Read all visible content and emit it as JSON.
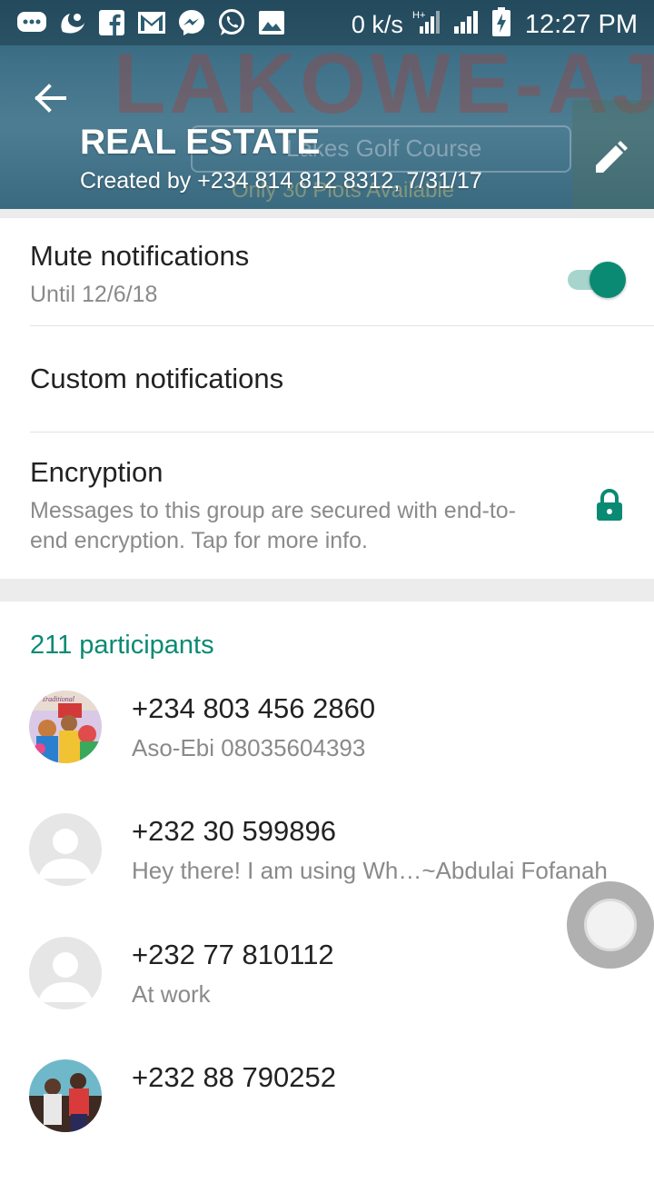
{
  "status_bar": {
    "net_speed": "0 k/s",
    "time": "12:27 PM",
    "left_icons": [
      "chat-bubble-icon",
      "uc-browser-icon",
      "facebook-icon",
      "gmail-icon",
      "messenger-icon",
      "whatsapp-icon",
      "gallery-icon"
    ],
    "right_icons": [
      "h-plus-signal-icon",
      "cell-signal-icon",
      "battery-charging-icon"
    ]
  },
  "header": {
    "title": "REAL ESTATE",
    "subtitle": "Created by +234 814 812 8312, 7/31/17",
    "bg_text_main": "LAKOWE-AJAH",
    "bg_text_sub": "Lakes Golf Course",
    "bg_text_sub2": "Only 30 Plots Available",
    "accent_color": "#3f7189"
  },
  "settings": {
    "mute": {
      "title": "Mute notifications",
      "subtitle": "Until 12/6/18",
      "enabled": true
    },
    "custom": {
      "title": "Custom notifications"
    },
    "encryption": {
      "title": "Encryption",
      "subtitle": "Messages to this group are secured with end-to-end encryption. Tap for more info."
    }
  },
  "participants": {
    "count_label": "211 participants",
    "accent_color": "#0a8a73",
    "items": [
      {
        "name": "+234 803 456 2860",
        "status": "Aso-Ebi 08035604393",
        "avatar": "photo"
      },
      {
        "name": "+232 30 599896",
        "status": "Hey there! I am using Wh…~Abdulai Fofanah",
        "avatar": "default"
      },
      {
        "name": "+232 77 810112",
        "status": "At work",
        "avatar": "default"
      },
      {
        "name": "+232 88 790252",
        "status": "",
        "avatar": "photo"
      }
    ]
  }
}
